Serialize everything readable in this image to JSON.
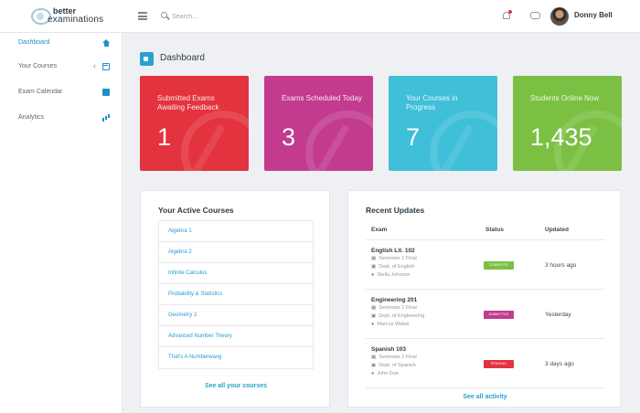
{
  "brand": {
    "line1": "better",
    "line2": "examinations"
  },
  "search": {
    "placeholder": "Search..."
  },
  "user": {
    "name": "Donny Bell"
  },
  "sidebar": {
    "items": [
      {
        "label": "Dashboard",
        "icon": "home-icon"
      },
      {
        "label": "Your Courses",
        "icon": "calendar-icon"
      },
      {
        "label": "Exam Calendar",
        "icon": "calendar-icon"
      },
      {
        "label": "Analytics",
        "icon": "bar-chart-icon"
      }
    ]
  },
  "page": {
    "title": "Dashboard"
  },
  "stats": [
    {
      "title": "Submitted Exams Awaiting Feedback",
      "value": "1",
      "color": "#e3333e"
    },
    {
      "title": "Exams Scheduled Today",
      "value": "3",
      "color": "#c23b8f"
    },
    {
      "title": "Your Courses in Progress",
      "value": "7",
      "color": "#3fbfd8"
    },
    {
      "title": "Students Online Now",
      "value": "1,435",
      "color": "#7bc043"
    }
  ],
  "courses": {
    "title": "Your Active Courses",
    "items": [
      "Algebra 1",
      "Algebra 2",
      "Infinite Calculus",
      "Probability & Statistics",
      "Geometry 2",
      "Advanced Number Theory",
      "That's A Numberwang"
    ],
    "see_all": "See all your courses"
  },
  "updates": {
    "title": "Recent Updates",
    "headers": {
      "exam": "Exam",
      "status": "Status",
      "updated": "Updated"
    },
    "rows": [
      {
        "exam": "English Lit. 102",
        "semester": "Semester 1 Final",
        "dept": "Dept. of English",
        "person": "Stella Johnson",
        "status": "COMPLETE",
        "status_color": "#7bc043",
        "updated": "3 hours ago"
      },
      {
        "exam": "Engineering 201",
        "semester": "Semester 1 Final",
        "dept": "Dept. of Engineering",
        "person": "Marcus Webel",
        "status": "SUBMITTED",
        "status_color": "#c23b8f",
        "updated": "Yesterday"
      },
      {
        "exam": "Spanish 103",
        "semester": "Semester 2 Final",
        "dept": "Dept. of Spanish",
        "person": "John Doe",
        "status": "PENDING",
        "status_color": "#e3333e",
        "updated": "3 days ago"
      }
    ],
    "see_all": "See all activity"
  }
}
